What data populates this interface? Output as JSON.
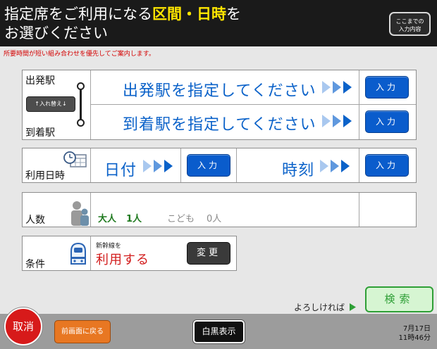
{
  "header": {
    "title_part1": "指定席をご利用になる",
    "title_em": "区間・日時",
    "title_part2": "を",
    "title_line2": "お選びください",
    "summary_button_line1": "ここまでの",
    "summary_button_line2": "入力内容"
  },
  "notice": "所要時間が短い組み合わせを優先してご案内します。",
  "station": {
    "departure_label": "出発駅",
    "arrival_label": "到着駅",
    "swap_label": "↑入れ替え↓",
    "departure_prompt": "出発駅を指定してください",
    "arrival_prompt": "到着駅を指定してください",
    "input_label": "入力"
  },
  "datetime": {
    "label": "利用日時",
    "date_label": "日付",
    "time_label": "時刻",
    "input_label": "入力"
  },
  "people": {
    "label": "人数",
    "adult_label": "大人",
    "adult_count": "1人",
    "child_label": "こども",
    "child_count": "0人"
  },
  "condition": {
    "label": "条件",
    "shinkansen_small": "新幹線を",
    "shinkansen_value": "利用する",
    "change_label": "変更"
  },
  "confirm_text": "よろしければ",
  "search_label": "検索",
  "footer": {
    "cancel_label": "取消",
    "back_label": "前画面に戻る",
    "bw_label": "白黒表示",
    "date": "7月17日",
    "time": "11時46分"
  },
  "colors": {
    "accent_blue": "#0b62c9",
    "title_highlight": "#ffe600",
    "cancel_red": "#d71a1a",
    "back_orange": "#e87722",
    "search_green": "#2e9f36"
  }
}
